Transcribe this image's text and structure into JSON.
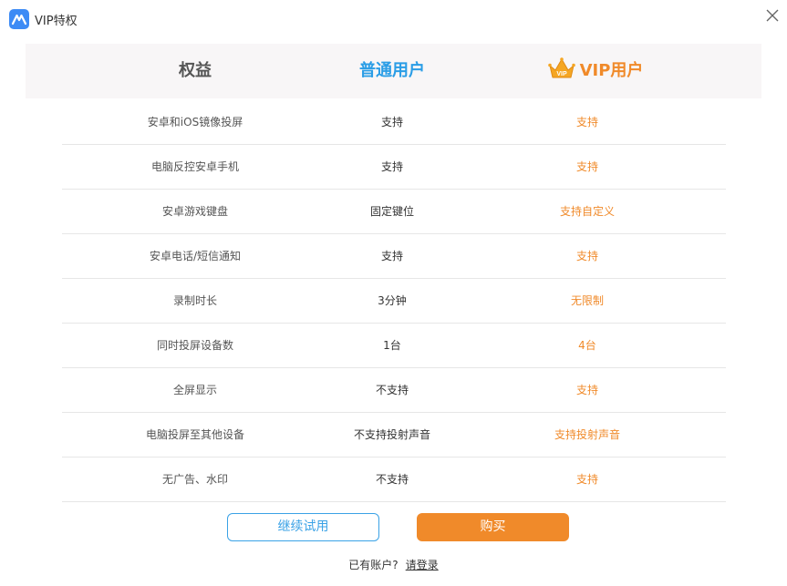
{
  "window": {
    "title": "VIP特权"
  },
  "columns": {
    "benefit": "权益",
    "normal": "普通用户",
    "vip": "VIP用户",
    "crown_badge": "VIP"
  },
  "rows": [
    {
      "benefit": "安卓和iOS镜像投屏",
      "normal": "支持",
      "vip": "支持"
    },
    {
      "benefit": "电脑反控安卓手机",
      "normal": "支持",
      "vip": "支持"
    },
    {
      "benefit": "安卓游戏键盘",
      "normal": "固定键位",
      "vip": "支持自定义"
    },
    {
      "benefit": "安卓电话/短信通知",
      "normal": "支持",
      "vip": "支持"
    },
    {
      "benefit": "录制时长",
      "normal": "3分钟",
      "vip": "无限制"
    },
    {
      "benefit": "同时投屏设备数",
      "normal": "1台",
      "vip": "4台"
    },
    {
      "benefit": "全屏显示",
      "normal": "不支持",
      "vip": "支持"
    },
    {
      "benefit": "电脑投屏至其他设备",
      "normal": "不支持投射声音",
      "vip": "支持投射声音"
    },
    {
      "benefit": "无广告、水印",
      "normal": "不支持",
      "vip": "支持"
    }
  ],
  "actions": {
    "trial_label": "继续试用",
    "buy_label": "购买"
  },
  "login": {
    "prompt": "已有账户?",
    "link": "请登录"
  },
  "colors": {
    "accent_blue": "#2a9de6",
    "accent_orange": "#f08a2a"
  },
  "icons": {
    "app": "app-logo-icon",
    "close": "close-icon",
    "crown": "crown-icon"
  }
}
